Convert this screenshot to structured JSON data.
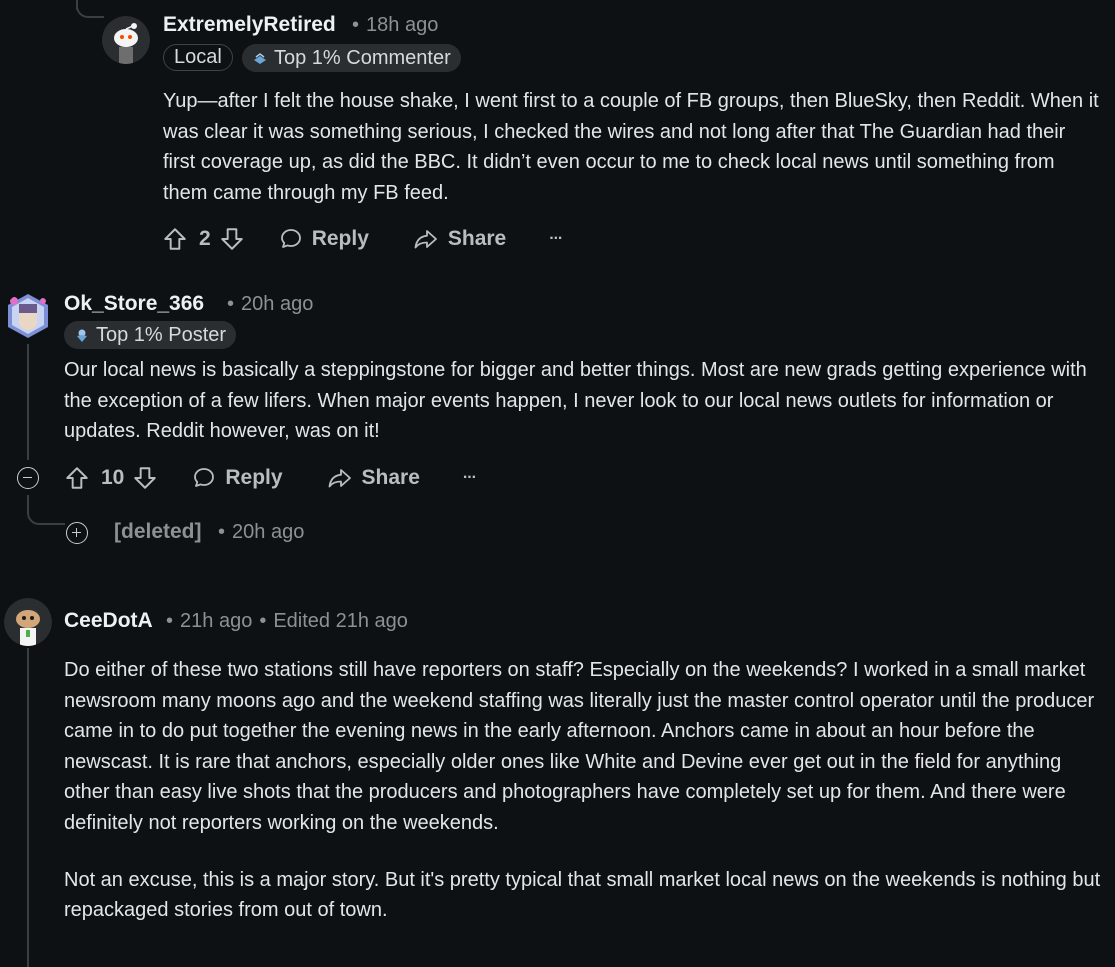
{
  "comments": [
    {
      "username": "ExtremelyRetired",
      "time": "18h ago",
      "flairs": [
        "Local",
        "Top 1% Commenter"
      ],
      "body": "Yup—after I felt the house shake, I went first to a couple of FB groups, then BlueSky, then Reddit. When it was clear it was something serious, I checked the wires and not long after that The Guardian had their first coverage up, as did the BBC. It didn’t even occur to me to check local news until something from them came through my FB feed.",
      "score": "2",
      "reply_label": "Reply",
      "share_label": "Share",
      "more_label": "···"
    },
    {
      "username": "Ok_Store_366",
      "time": "20h ago",
      "flairs": [
        "Top 1% Poster"
      ],
      "body": "Our local news is basically a steppingstone for bigger and better things. Most are new grads getting experience with the exception of a few lifers. When major events happen, I never look to our local news outlets for information or updates. Reddit however, was on it!",
      "score": "10",
      "reply_label": "Reply",
      "share_label": "Share",
      "more_label": "···",
      "collapse_icon": "minus-circle-icon"
    },
    {
      "username": "[deleted]",
      "time": "20h ago",
      "expand_icon": "plus-circle-icon"
    },
    {
      "username": "CeeDotA",
      "time": "21h ago",
      "edited": "Edited 21h ago",
      "body_p1": "Do either of these two stations still have reporters on staff? Especially on the weekends? I worked in a small market newsroom many moons ago and the weekend staffing was literally just the master control operator until the producer came in to do put together the evening news in the early afternoon. Anchors came in about an hour before the newscast. It is rare that anchors, especially older ones like White and Devine ever get out in the field for anything other than easy live shots that the producers and photographers have completely set up for them. And there were definitely not reporters working on the weekends.",
      "body_p2": "Not an excuse, this is a major story. But it's pretty typical that small market local news on the weekends is nothing but repackaged stories from out of town."
    }
  ],
  "colors": {
    "background": "#0e1113",
    "text": "#d7dadc",
    "muted": "#8c9196"
  }
}
